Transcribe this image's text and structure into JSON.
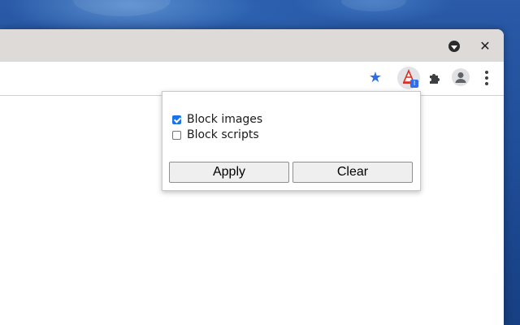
{
  "window": {
    "tab_search_icon": "chevron-down-circle-icon",
    "close_glyph": "✕"
  },
  "toolbar": {
    "bookmark_icon": "star-icon",
    "bookmark_glyph": "★",
    "extension": {
      "icon": "traffic-cone-icon",
      "badge_text": "I",
      "badge_color": "#2f6ef0"
    },
    "extensions_icon": "puzzle-icon",
    "profile_icon": "person-icon",
    "menu_icon": "kebab-menu-icon"
  },
  "popup": {
    "options": [
      {
        "label": "Block images",
        "checked": true
      },
      {
        "label": "Block scripts",
        "checked": false
      }
    ],
    "apply_label": "Apply",
    "clear_label": "Clear"
  },
  "colors": {
    "accent": "#1a73e8",
    "star": "#2a6ee8",
    "tabstrip": "#dedad8"
  }
}
